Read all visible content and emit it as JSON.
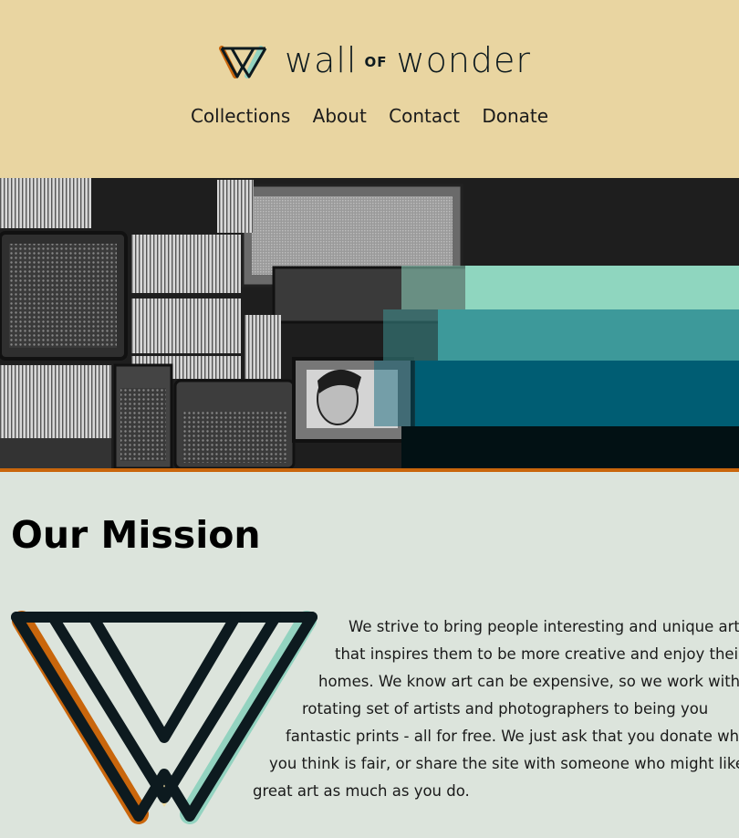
{
  "header": {
    "brand": {
      "name_left": "wall",
      "name_of": "OF",
      "name_right": "wonder"
    },
    "nav": [
      "Collections",
      "About",
      "Contact",
      "Donate"
    ]
  },
  "colors": {
    "header_bg": "#e9d5a1",
    "page_bg": "#dce4dc",
    "orange": "#c9660c",
    "mint": "#93d3c0",
    "cream": "#eedba2",
    "dark": "#0d1a1f"
  },
  "hero": {
    "stripes": [
      "#b01b05",
      "#d94d1a",
      "#f59b34",
      "#ecd59b",
      "#8fd6bf",
      "#3d999a",
      "#005d73",
      "#021114"
    ]
  },
  "mission": {
    "title": "Our Mission",
    "lines": [
      "We strive to bring people interesting and unique art",
      "that inspires them to be more creative and enjoy their",
      "homes. We know art can be expensive, so we work with a",
      "rotating set of artists and photographers to being you",
      "fantastic prints - all for free. We just ask that you donate what",
      "you think is fair, or share the site with someone who might like",
      "great art as much as you do."
    ]
  }
}
